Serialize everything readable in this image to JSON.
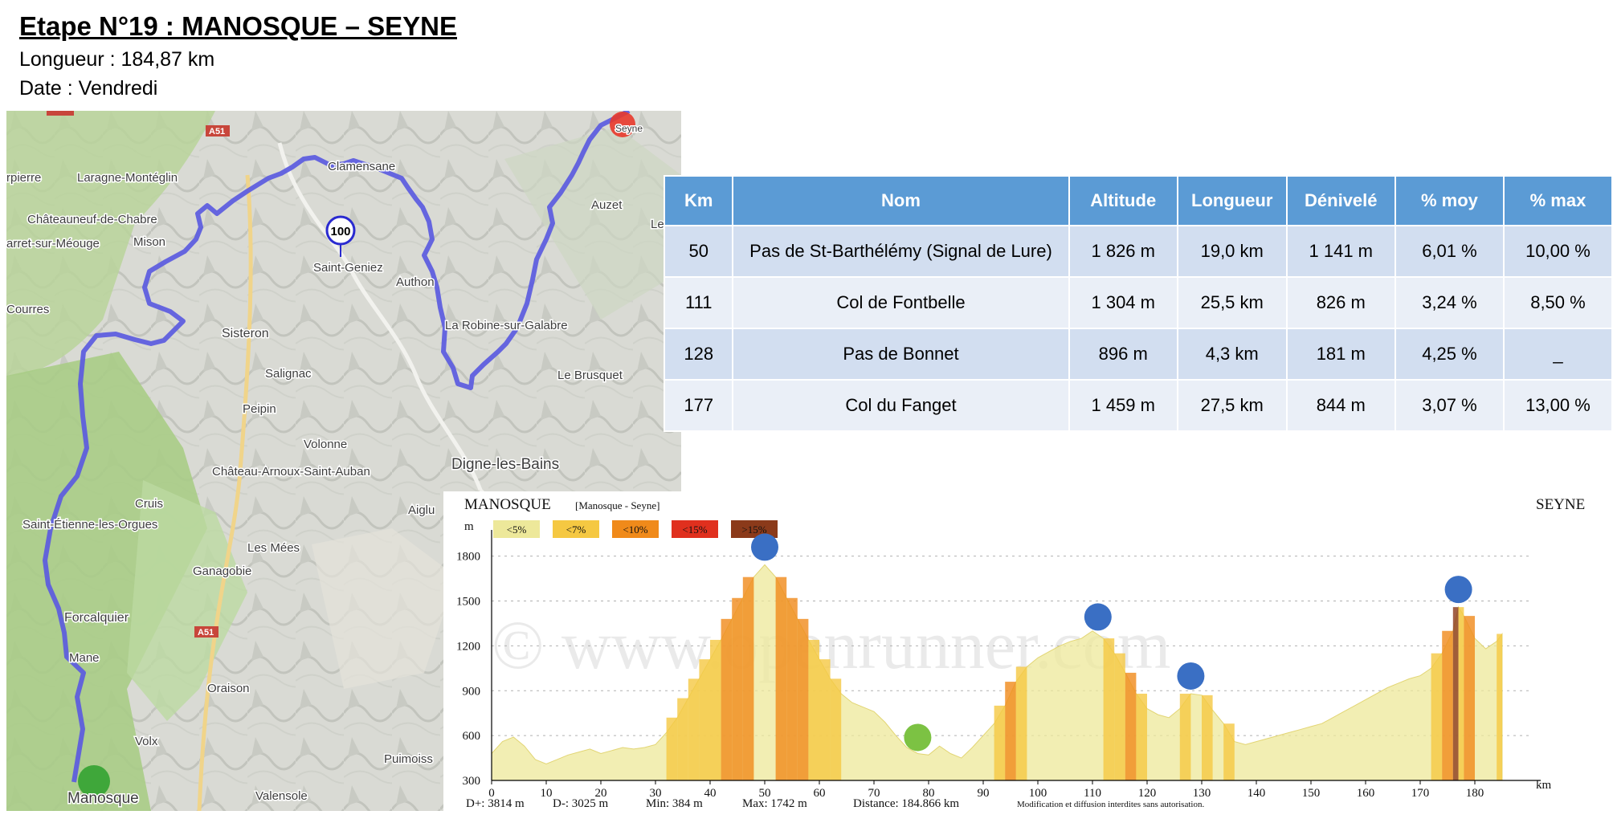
{
  "header": {
    "title": "Etape N°19 : MANOSQUE – SEYNE",
    "length": "Longueur : 184,87 km",
    "date": "Date : Vendredi"
  },
  "map": {
    "km_marker": "100",
    "road_labels": [
      "A51",
      "A51",
      "A51"
    ],
    "places": [
      "Seyne",
      "Clamensane",
      "Laragne-Montéglin",
      "Châteauneuf-de-Chabre",
      "Mison",
      "arret-sur-Méouge",
      "rpierre",
      "Saint-Geniez",
      "Authon",
      "Auzet",
      "Le Ve",
      "Sisteron",
      "La Robine-sur-Galabre",
      "Le Brusquet",
      "Salignac",
      "Peipin",
      "Volonne",
      "Château-Arnoux-Saint-Auban",
      "Digne-les-Bains",
      "Aiglu",
      "Cruis",
      "Saint-Étienne-les-Orgues",
      "Les Mées",
      "Ganagobie",
      "Forcalquier",
      "Mane",
      "Oraison",
      "Volx",
      "Puimoiss",
      "Valensole",
      "Manosque",
      "Courres"
    ],
    "colors": {
      "route": "#5b5bdf",
      "start": "#2ca02c",
      "finish": "#e8392b"
    }
  },
  "table": {
    "headers": [
      "Km",
      "Nom",
      "Altitude",
      "Longueur",
      "Dénivelé",
      "% moy",
      "% max"
    ],
    "rows": [
      [
        "50",
        "Pas de St-Barthélémy (Signal de Lure)",
        "1 826 m",
        "19,0 km",
        "1 141 m",
        "6,01 %",
        "10,00 %"
      ],
      [
        "111",
        "Col de Fontbelle",
        "1 304 m",
        "25,5 km",
        "826 m",
        "3,24 %",
        "8,50 %"
      ],
      [
        "128",
        "Pas de Bonnet",
        "896 m",
        "4,3 km",
        "181 m",
        "4,25 %",
        "_"
      ],
      [
        "177",
        "Col du Fanget",
        "1 459 m",
        "27,5 km",
        "844 m",
        "3,07 %",
        "13,00 %"
      ]
    ]
  },
  "profile": {
    "start_label": "MANOSQUE",
    "route_label": "[Manosque - Seyne]",
    "end_label": "SEYNE",
    "y_unit": "m",
    "x_unit": "km",
    "legend": [
      {
        "label": "<5%",
        "color": "#ede89a"
      },
      {
        "label": "<7%",
        "color": "#f5c842"
      },
      {
        "label": "<10%",
        "color": "#f08a1a"
      },
      {
        "label": "<15%",
        "color": "#e0301e"
      },
      {
        "label": ">15%",
        "color": "#8b3a1a"
      }
    ],
    "watermark": "© www.openrunner.com",
    "stats": [
      "D+: 3814 m",
      "D-: 3025 m",
      "Min: 384 m",
      "Max: 1742 m",
      "Distance: 184.866 km",
      "Modification et diffusion interdites sans autorisation."
    ],
    "colors": {
      "climb_marker": "#3a6fc4",
      "feed_marker": "#7cc243"
    }
  },
  "chart_data": {
    "type": "area",
    "xlim": [
      0,
      190
    ],
    "ylim": [
      300,
      1900
    ],
    "x_ticks": [
      0,
      10,
      20,
      30,
      40,
      50,
      60,
      70,
      80,
      90,
      100,
      110,
      120,
      130,
      140,
      150,
      160,
      170,
      180
    ],
    "y_ticks": [
      300,
      600,
      900,
      1200,
      1500,
      1800
    ],
    "x": [
      0,
      2,
      4,
      6,
      8,
      10,
      12,
      14,
      16,
      18,
      20,
      22,
      24,
      26,
      28,
      30,
      32,
      34,
      36,
      38,
      40,
      42,
      44,
      46,
      48,
      50,
      52,
      54,
      56,
      58,
      60,
      62,
      64,
      66,
      68,
      70,
      72,
      74,
      76,
      78,
      80,
      82,
      84,
      86,
      88,
      90,
      92,
      94,
      96,
      98,
      100,
      102,
      104,
      106,
      108,
      110,
      112,
      114,
      116,
      118,
      120,
      122,
      124,
      126,
      128,
      130,
      132,
      134,
      136,
      138,
      140,
      142,
      144,
      146,
      148,
      150,
      152,
      154,
      156,
      158,
      160,
      162,
      164,
      166,
      168,
      170,
      172,
      174,
      176,
      177,
      178,
      180,
      182,
      184,
      185
    ],
    "series": [
      {
        "values": [
          480,
          560,
          590,
          530,
          440,
          410,
          440,
          470,
          490,
          510,
          480,
          500,
          520,
          510,
          520,
          540,
          620,
          720,
          850,
          980,
          1110,
          1240,
          1380,
          1520,
          1660,
          1742,
          1660,
          1520,
          1380,
          1240,
          1110,
          980,
          880,
          820,
          790,
          760,
          690,
          600,
          520,
          480,
          470,
          530,
          480,
          450,
          520,
          600,
          680,
          800,
          960,
          1060,
          1120,
          1160,
          1200,
          1230,
          1250,
          1300,
          1250,
          1150,
          1020,
          880,
          780,
          740,
          720,
          780,
          880,
          870,
          770,
          680,
          560,
          540,
          560,
          580,
          600,
          620,
          640,
          660,
          680,
          720,
          760,
          800,
          840,
          880,
          920,
          950,
          980,
          1000,
          1050,
          1150,
          1300,
          1459,
          1400,
          1250,
          1180,
          1230,
          1280
        ]
      }
    ],
    "climb_markers_km": [
      50,
      111,
      128,
      177
    ],
    "feed_marker_km": 78
  }
}
